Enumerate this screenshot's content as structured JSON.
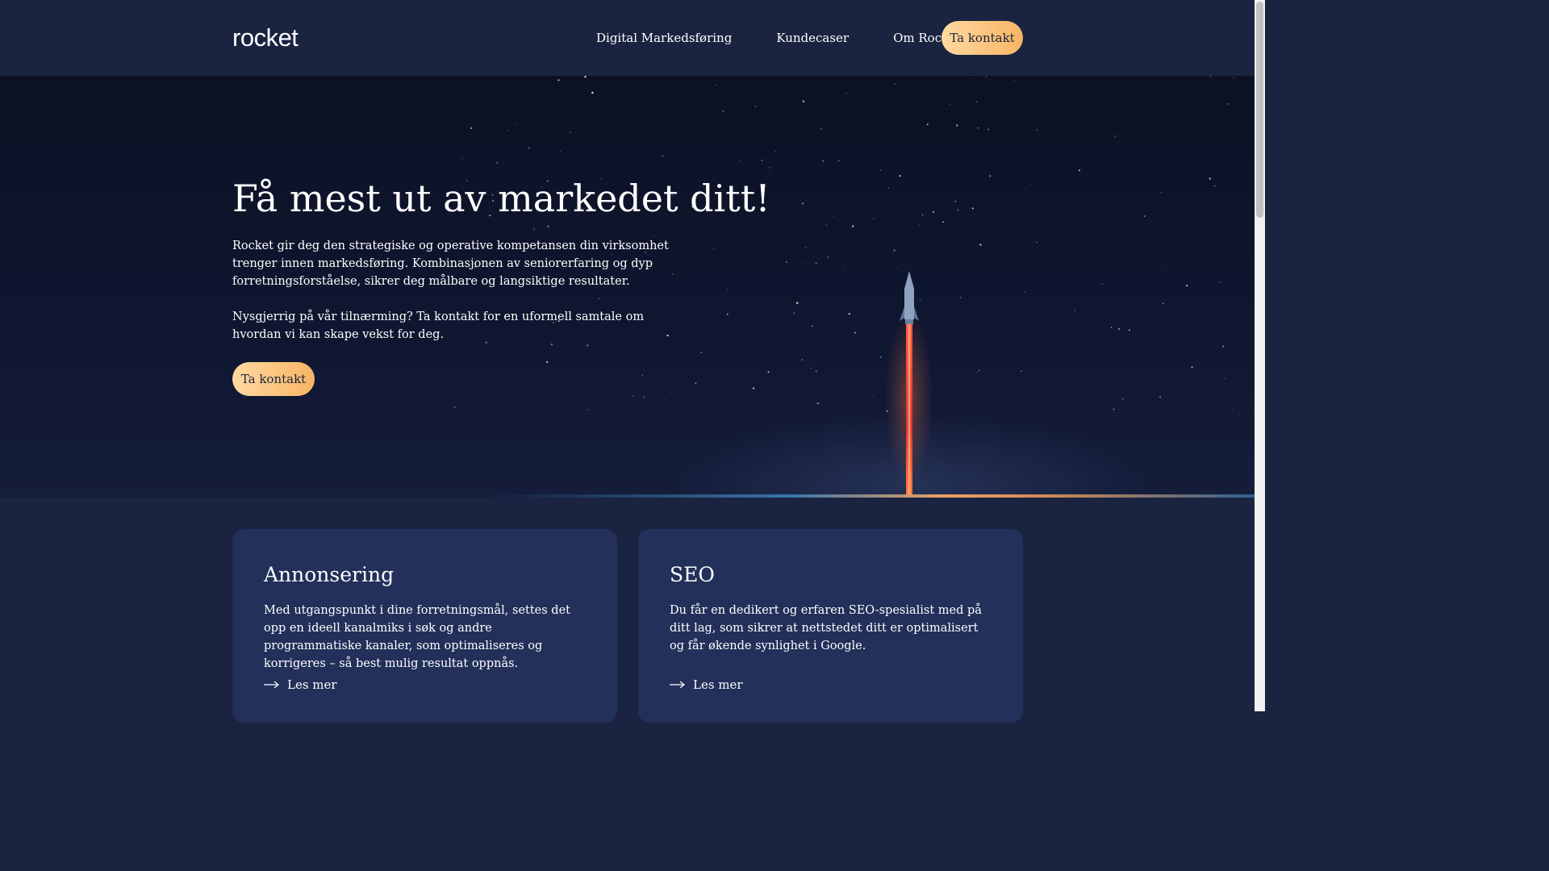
{
  "header": {
    "logo": "rocket",
    "nav": [
      "Digital Markedsføring",
      "Kundecaser",
      "Om Rocket"
    ],
    "cta_label": "Ta kontakt"
  },
  "hero": {
    "title": "Få mest ut av markedet ditt!",
    "paragraph1": "Rocket gir deg den strategiske og operative kompetansen din virksomhet trenger innen markedsføring. Kombinasjonen av seniorerfaring og dyp forretningsforståelse, sikrer deg målbare og langsiktige resultater.",
    "paragraph2": "Nysgjerrig på vår tilnærming? Ta kontakt for en uformell samtale om hvordan vi kan skape vekst for deg.",
    "cta_label": "Ta kontakt"
  },
  "cards": [
    {
      "title": "Annonsering",
      "text": "Med utgangspunkt i dine forretningsmål, settes det opp en ideell kanalmiks i søk og andre programmatiske kanaler, som optimaliseres og korrigeres – så best mulig resultat oppnås.",
      "link_label": "Les mer"
    },
    {
      "title": "SEO",
      "text": "Du får en dedikert og erfaren SEO-spesialist med på ditt lag, som sikrer at nettstedet ditt er optimalisert og får økende synlighet i Google.",
      "link_label": "Les mer"
    }
  ],
  "colors": {
    "background": "#1a2340",
    "card": "#22305a",
    "button_gradient_start": "#ffd9a0",
    "button_gradient_end": "#f8b565",
    "button_text": "#1a2340"
  },
  "icons": {
    "card_link": "arrow-right-icon",
    "hero_illustration": "rocket-launch-illustration"
  }
}
